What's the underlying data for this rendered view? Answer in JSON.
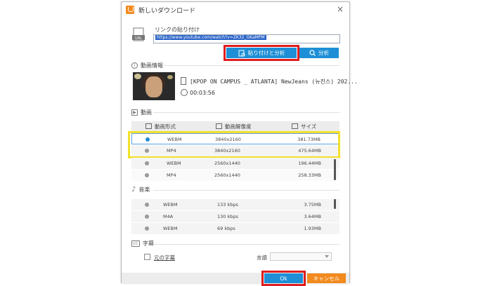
{
  "dialog": {
    "title": "新しいダウンロード"
  },
  "url": {
    "label": "リンクの貼り付け",
    "value": "https://www.youtube.com/watch?v=ZK32_GKaMPM"
  },
  "buttons": {
    "paste_analyze": "貼り付けと分析",
    "analyze": "分析",
    "ok": "Ok",
    "cancel": "キャンセル"
  },
  "info": {
    "section": "動画情報",
    "title": "[KPOP ON CAMPUS _ ATLANTA] NewJeans (뉴진스) 202...",
    "duration": "00:03:56"
  },
  "video": {
    "section": "動画",
    "headers": {
      "format": "動画形式",
      "resolution": "動画解像度",
      "size": "サイズ"
    },
    "rows": [
      {
        "format": "WEBM",
        "resolution": "3840x2160",
        "size": "381.73MB"
      },
      {
        "format": "MP4",
        "resolution": "3840x2160",
        "size": "475.64MB"
      },
      {
        "format": "WEBM",
        "resolution": "2560x1440",
        "size": "196.44MB"
      },
      {
        "format": "MP4",
        "resolution": "2560x1440",
        "size": "258.33MB"
      }
    ]
  },
  "audio": {
    "section": "音楽",
    "rows": [
      {
        "format": "WEBM",
        "bitrate": "133 kbps",
        "size": "3.75MB"
      },
      {
        "format": "M4A",
        "bitrate": "130 kbps",
        "size": "3.64MB"
      },
      {
        "format": "WEBM",
        "bitrate": "69 kbps",
        "size": "1.93MB"
      }
    ]
  },
  "subtitles": {
    "section": "字幕",
    "original_label": "元の字幕",
    "language_label": "言語",
    "language_value": ""
  },
  "colors": {
    "accent": "#1e8fd6",
    "cancel": "#f28a1e",
    "highlight_red": "#e01e1e",
    "highlight_yellow": "#f2e12a"
  }
}
